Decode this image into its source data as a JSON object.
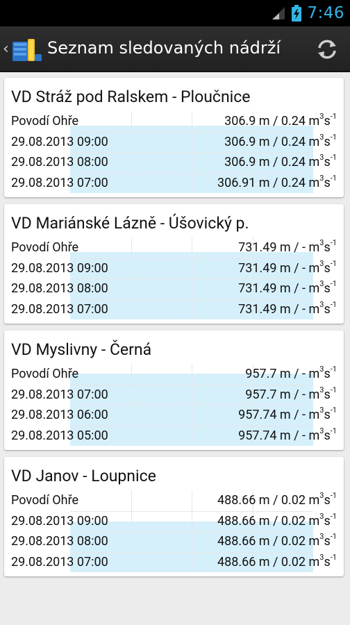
{
  "status_bar": {
    "time": "7:46",
    "icons": [
      "signal-icon",
      "battery-charging-icon"
    ],
    "time_color": "#33b5e5"
  },
  "action_bar": {
    "title": "Seznam sledovaných nádrží",
    "icons": [
      "up-caret-icon",
      "app-logo-icon",
      "refresh-icon"
    ]
  },
  "colors": {
    "chart_fill": "#d6f0fb",
    "card_bg": "#ffffff",
    "page_bg": "#ececec"
  },
  "reservoirs": [
    {
      "name": "VD Stráž pod Ralskem - Ploučnice",
      "basin": "Povodí Ohře",
      "current": "306.9 m / 0.24 m",
      "fill_level": 0.82,
      "history": [
        {
          "time": "29.08.2013 09:00",
          "value": "306.9 m / 0.24 m"
        },
        {
          "time": "29.08.2013 08:00",
          "value": "306.9 m / 0.24 m"
        },
        {
          "time": "29.08.2013 07:00",
          "value": "306.91 m / 0.24 m"
        }
      ]
    },
    {
      "name": "VD Mariánské Lázně - Úšovický p.",
      "basin": "Povodí Ohře",
      "current": "731.49 m / - m",
      "fill_level": 0.82,
      "history": [
        {
          "time": "29.08.2013 09:00",
          "value": "731.49 m / - m"
        },
        {
          "time": "29.08.2013 08:00",
          "value": "731.49 m / - m"
        },
        {
          "time": "29.08.2013 07:00",
          "value": "731.49 m / - m"
        }
      ]
    },
    {
      "name": "VD Myslivny - Černá",
      "basin": "Povodí Ohře",
      "current": "957.7 m / - m",
      "fill_level": 0.88,
      "history": [
        {
          "time": "29.08.2013 07:00",
          "value": "957.7 m / - m"
        },
        {
          "time": "29.08.2013 06:00",
          "value": "957.74 m / - m"
        },
        {
          "time": "29.08.2013 05:00",
          "value": "957.74 m / - m"
        }
      ]
    },
    {
      "name": "VD Janov - Loupnice",
      "basin": "Povodí Ohře",
      "current": "488.66 m / 0.02 m",
      "fill_level": 0.62,
      "history": [
        {
          "time": "29.08.2013 09:00",
          "value": "488.66 m / 0.02 m"
        },
        {
          "time": "29.08.2013 08:00",
          "value": "488.66 m / 0.02 m"
        },
        {
          "time": "29.08.2013 07:00",
          "value": "488.66 m / 0.02 m"
        }
      ]
    }
  ],
  "unit_suffix": {
    "sup1": "3",
    "mid": "s",
    "sup2": "-1"
  }
}
